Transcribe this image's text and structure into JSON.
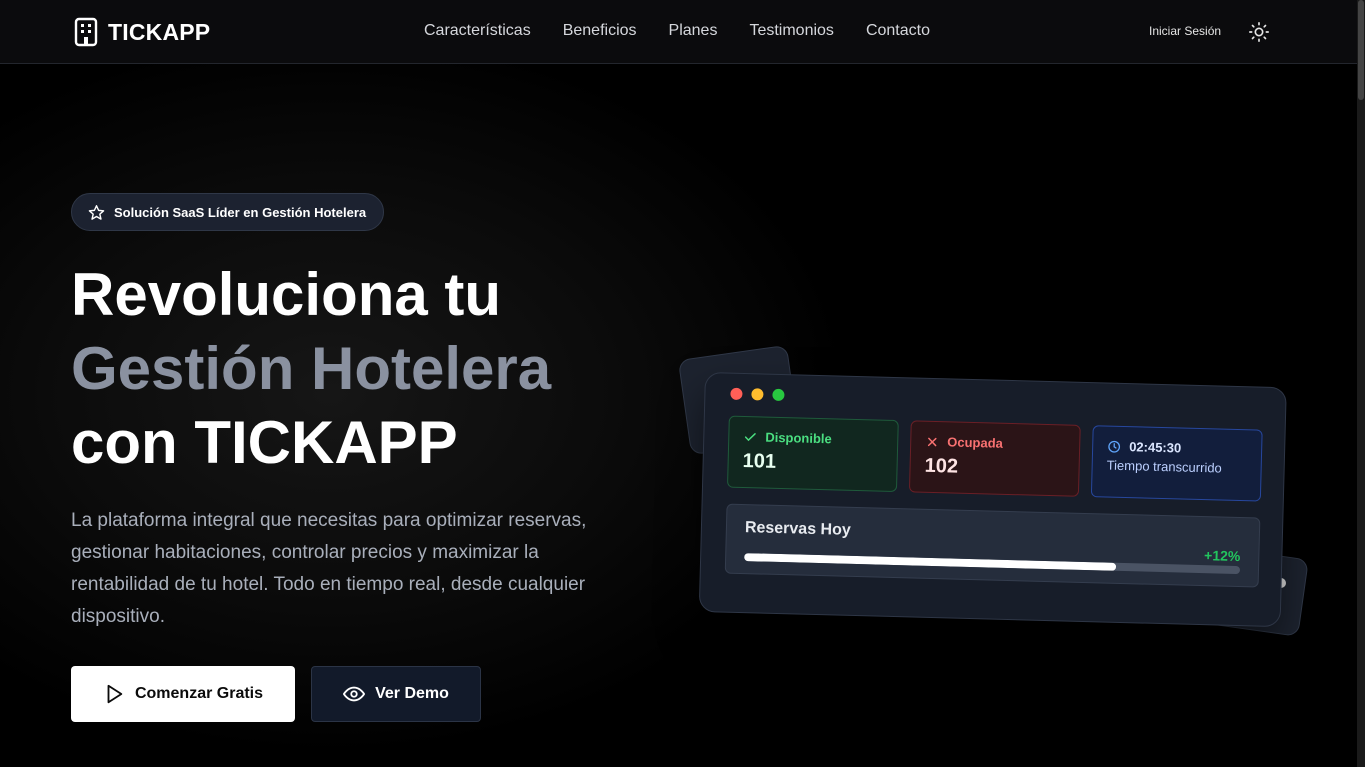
{
  "header": {
    "brand": "TICKAPP",
    "nav": [
      "Características",
      "Beneficios",
      "Planes",
      "Testimonios",
      "Contacto"
    ],
    "login": "Iniciar Sesión",
    "theme_icon": "sun-icon"
  },
  "hero": {
    "badge": "Solución SaaS Líder en Gestión Hotelera",
    "title_line1": "Revoluciona tu",
    "title_line2": "Gestión Hotelera",
    "title_line3": "con TICKAPP",
    "description": "La plataforma integral que necesitas para optimizar reservas, gestionar habitaciones, controlar precios y maximizar la rentabilidad de tu hotel. Todo en tiempo real, desde cualquier dispositivo.",
    "primary_cta": "Comenzar Gratis",
    "secondary_cta": "Ver Demo"
  },
  "dashboard": {
    "available": {
      "label": "Disponible",
      "value": "101",
      "color": "#4ade80"
    },
    "occupied": {
      "label": "Ocupada",
      "value": "102",
      "color": "#f87171"
    },
    "timer": {
      "time": "02:45:30",
      "label": "Tiempo transcurrido",
      "color": "#60a5fa"
    },
    "reservations": {
      "label": "Reservas Hoy",
      "change": "+12%",
      "progress": 0.75
    }
  },
  "colors": {
    "window_red": "#ff5f57",
    "window_yellow": "#febc2e",
    "window_green": "#28c840",
    "positive": "#22c55e"
  }
}
